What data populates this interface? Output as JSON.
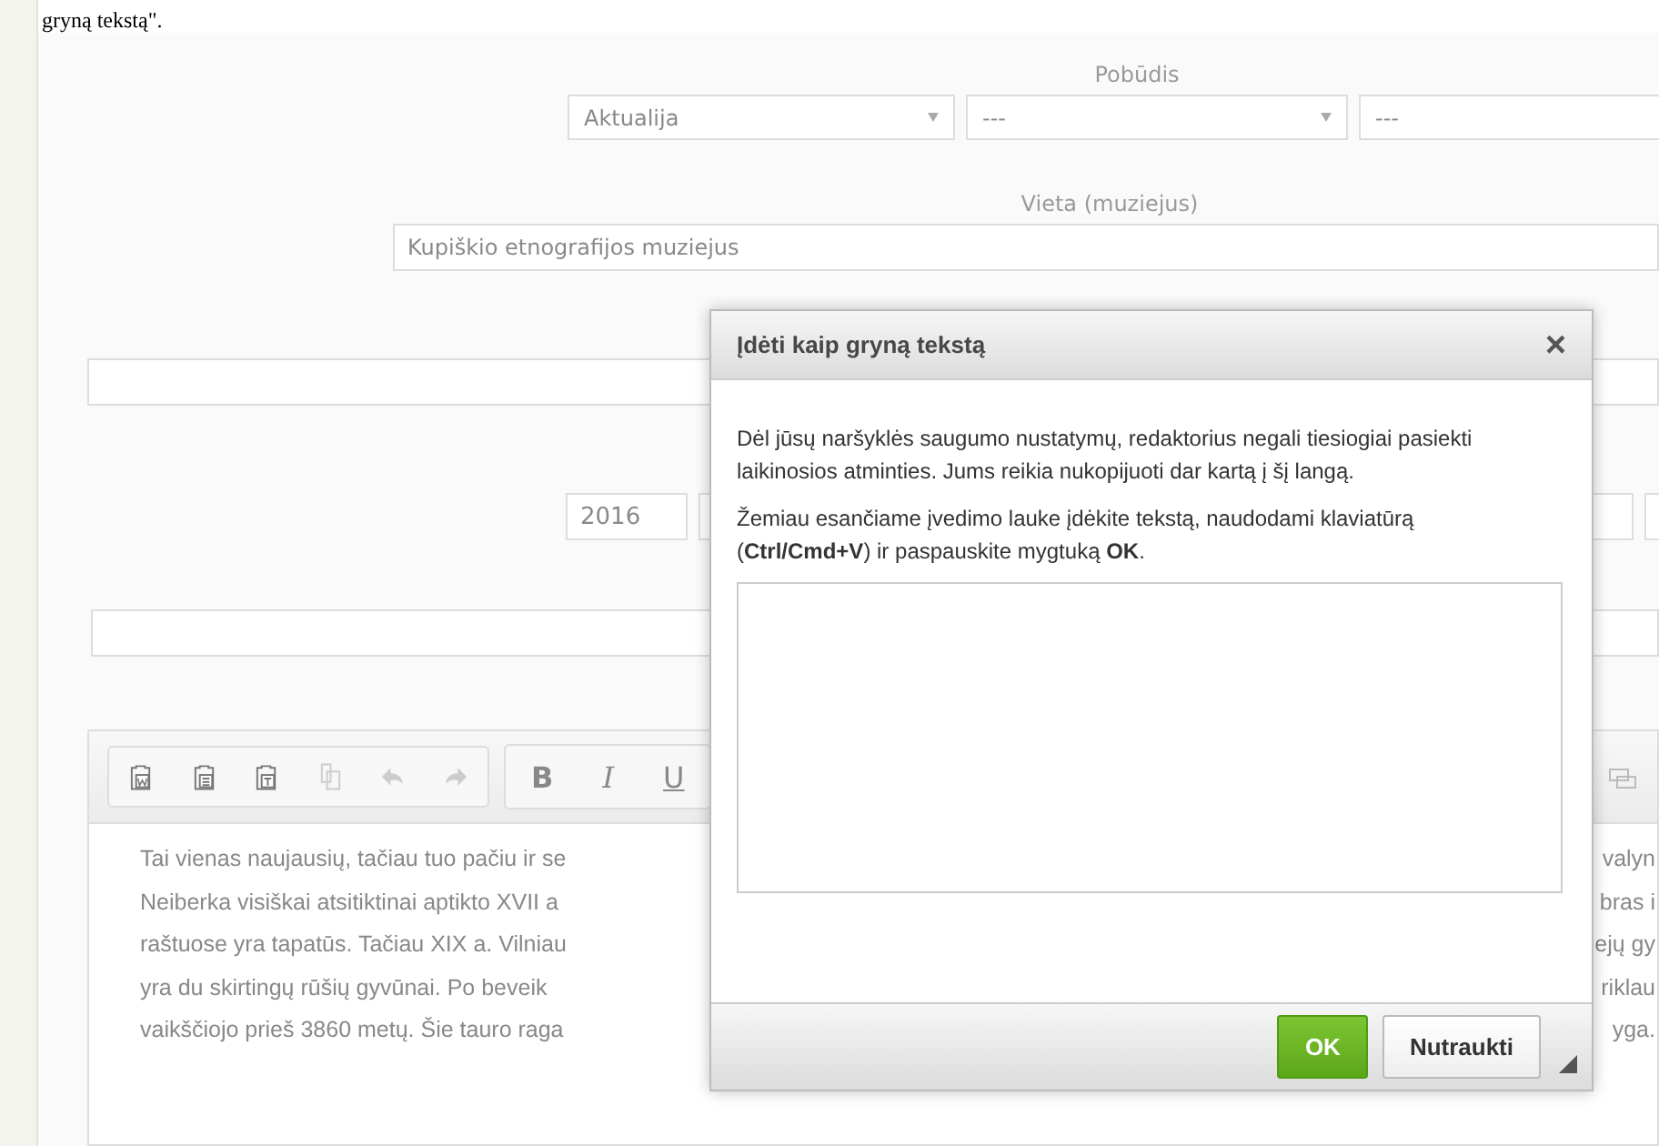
{
  "document_heading": "gryną tekstą\".",
  "form": {
    "type_label": "Pobūdis",
    "type_selects": [
      {
        "kind": "dropdown",
        "value": "Aktualija"
      },
      {
        "kind": "dropdown",
        "value": "---"
      },
      {
        "kind": "field",
        "value": "---"
      }
    ],
    "place_label": "Vieta (muziejus)",
    "place_value": "Kupiškio etnografijos muziejus",
    "year_value": "2016"
  },
  "editor": {
    "toolbar": [
      {
        "kind": "paste-word",
        "disabled": false
      },
      {
        "kind": "paste",
        "disabled": false
      },
      {
        "kind": "paste-text",
        "disabled": false
      },
      {
        "kind": "copy",
        "disabled": true
      },
      {
        "kind": "undo",
        "disabled": true
      },
      {
        "kind": "redo",
        "disabled": true
      }
    ],
    "format_buttons": [
      {
        "kind": "bold",
        "label": "B"
      },
      {
        "kind": "italic",
        "label": "I"
      },
      {
        "kind": "underline",
        "label": "U"
      }
    ],
    "lines": [
      {
        "left": "Tai vienas naujausių, tačiau tuo pačiu ir se",
        "right": "valyn"
      },
      {
        "left": "Neiberka visiškai atsitiktinai aptikto XVII a",
        "right": "bras i"
      },
      {
        "left": "raštuose yra tapatūs. Tačiau XIX a. Vilniau",
        "right": "ejų gy"
      },
      {
        "left": "yra du skirtingų rūšių gyvūnai. Po beveik",
        "right": "riklau"
      },
      {
        "left": "vaikščiojo prieš 3860  metų. Šie tauro raga",
        "right": "yga."
      }
    ]
  },
  "dialog": {
    "title": "Įdėti kaip gryną tekstą",
    "close": "×",
    "paragraphs": [
      "Dėl jūsų naršyklės saugumo nustatymų, redaktorius negali tiesiogiai pasiekti laikinosios atminties. Jums reikia nukopijuoti dar kartą į šį langą.",
      "Žemiau esančiame įvedimo lauke įdėkite tekstą, naudodami klaviatūrą (**Ctrl/Cmd+V**) ir paspauskite mygtuką **OK**."
    ],
    "buttons": [
      {
        "kind": "primary",
        "label": "OK"
      },
      {
        "kind": "secondary",
        "label": "Nutraukti"
      }
    ]
  }
}
